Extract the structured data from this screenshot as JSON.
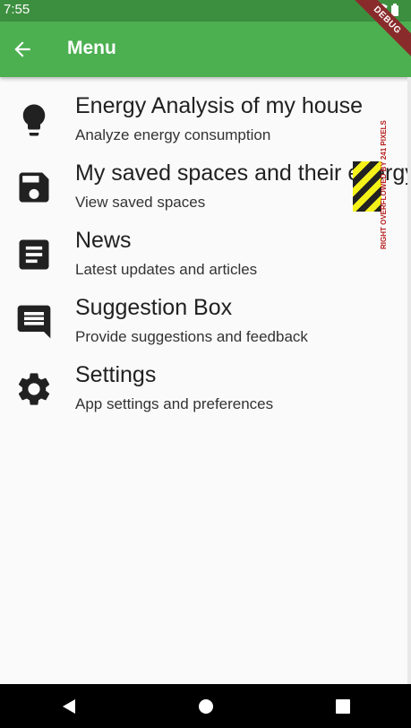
{
  "statusbar": {
    "time": "7:55"
  },
  "appbar": {
    "title": "Menu"
  },
  "debug_banner": "DEBUG",
  "items": [
    {
      "title": "Energy Analysis of my house",
      "subtitle": "Analyze energy consumption",
      "icon": "lightbulb-icon"
    },
    {
      "title": "My saved spaces and their energy",
      "subtitle": "View saved spaces",
      "icon": "save-icon"
    },
    {
      "title": "News",
      "subtitle": "Latest updates and articles",
      "icon": "article-icon"
    },
    {
      "title": "Suggestion Box",
      "subtitle": "Provide suggestions and feedback",
      "icon": "message-icon"
    },
    {
      "title": "Settings",
      "subtitle": "App settings and preferences",
      "icon": "gear-icon"
    }
  ],
  "overflow_warning": "RIGHT OVERFLOWED BY 241 PIXELS",
  "colors": {
    "appbar": "#4caf50",
    "statusbar": "#3d8f40",
    "background": "#fafafa"
  }
}
